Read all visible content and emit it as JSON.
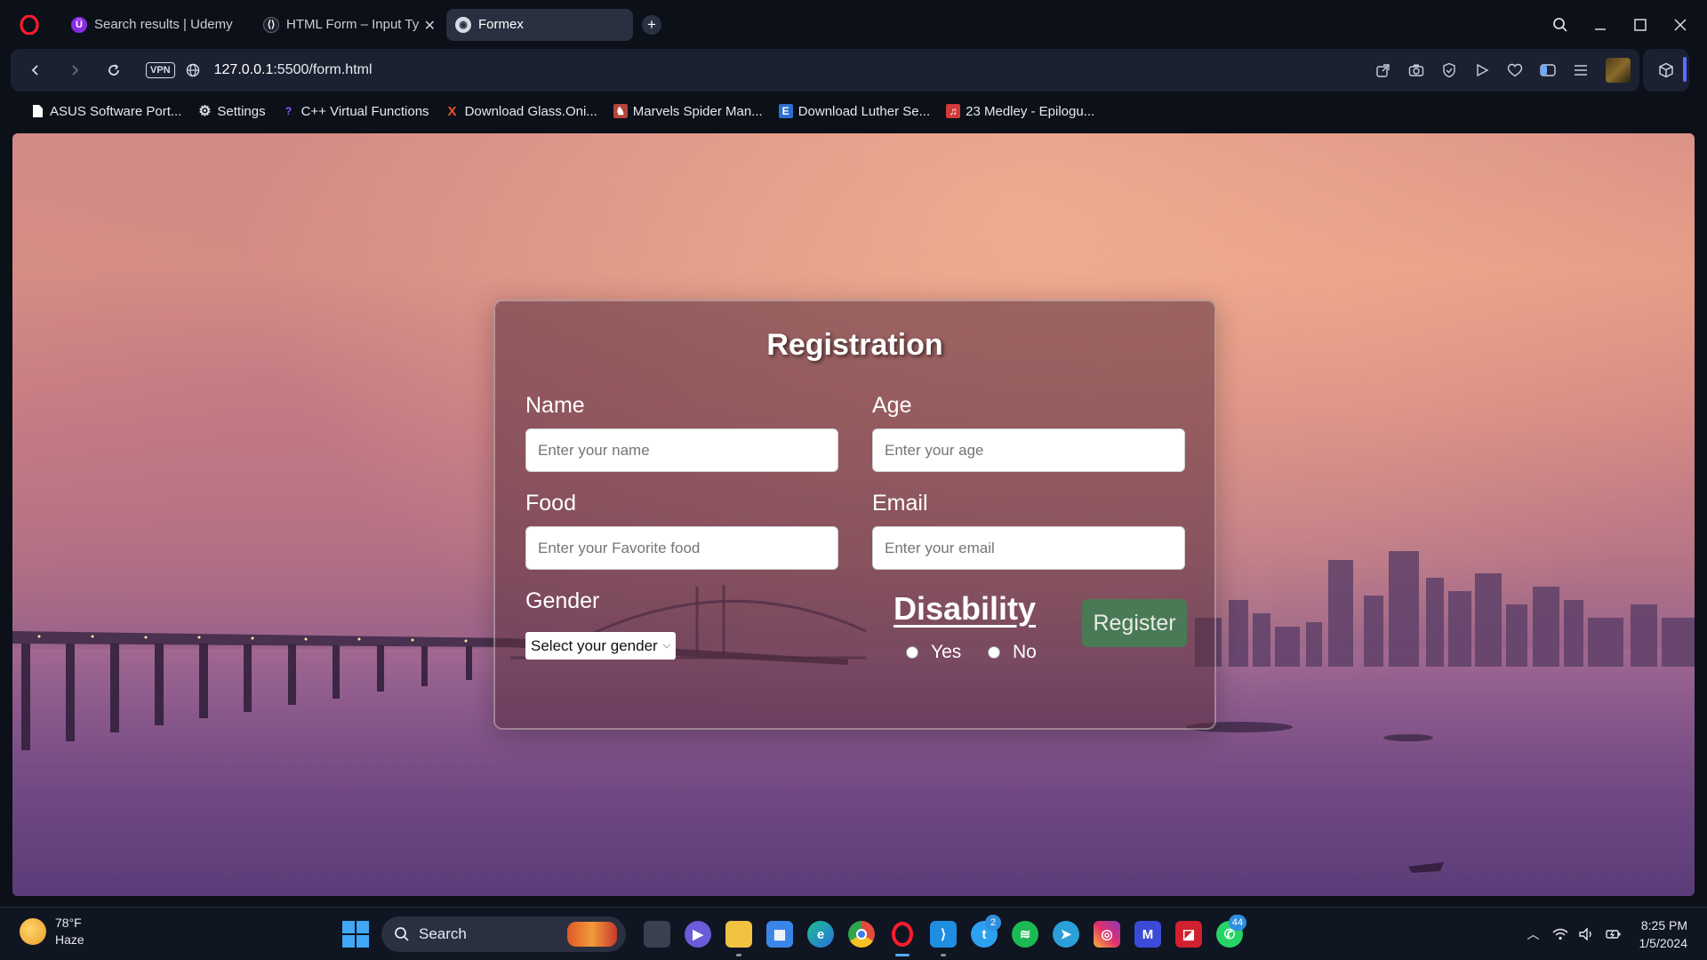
{
  "browser": {
    "tabs": [
      {
        "label": "Search results | Udemy",
        "favicon": "udemy-icon"
      },
      {
        "label": "HTML Form – Input Ty",
        "favicon": "freecodecamp-icon"
      },
      {
        "label": "Formex",
        "favicon": "globe-icon",
        "active": true
      }
    ],
    "address": {
      "host": "127.0.0.1",
      "path": ":5500/form.html",
      "vpn_label": "VPN"
    },
    "bookmarks": [
      {
        "label": "ASUS Software Port...",
        "icon": "document-icon"
      },
      {
        "label": "Settings",
        "icon": "gear-icon"
      },
      {
        "label": "C++ Virtual Functions",
        "icon": "question-icon"
      },
      {
        "label": "Download Glass.Oni...",
        "icon": "x-icon"
      },
      {
        "label": "Marvels Spider Man...",
        "icon": "spiderman-icon"
      },
      {
        "label": "Download Luther Se...",
        "icon": "e-icon"
      },
      {
        "label": "23 Medley - Epilogu...",
        "icon": "music-icon"
      }
    ]
  },
  "form": {
    "title": "Registration",
    "name": {
      "label": "Name",
      "placeholder": "Enter your name"
    },
    "age": {
      "label": "Age",
      "placeholder": "Enter your age"
    },
    "food": {
      "label": "Food",
      "placeholder": "Enter your Favorite food"
    },
    "email": {
      "label": "Email",
      "placeholder": "Enter your email"
    },
    "gender": {
      "label": "Gender",
      "selected": "Select your gender"
    },
    "disability": {
      "title": "Disability",
      "options": [
        "Yes",
        "No"
      ]
    },
    "register_label": "Register"
  },
  "taskbar": {
    "weather": {
      "temp": "78°F",
      "condition": "Haze"
    },
    "search_label": "Search",
    "badges": {
      "twitter": "2",
      "whatsapp": "44"
    },
    "time": "8:25 PM",
    "date": "1/5/2024"
  },
  "colors": {
    "card_bg": "#5a2d3c",
    "register_button": "#4a7a55",
    "browser_bg": "#0c1018",
    "accent": "#5b6cff"
  }
}
